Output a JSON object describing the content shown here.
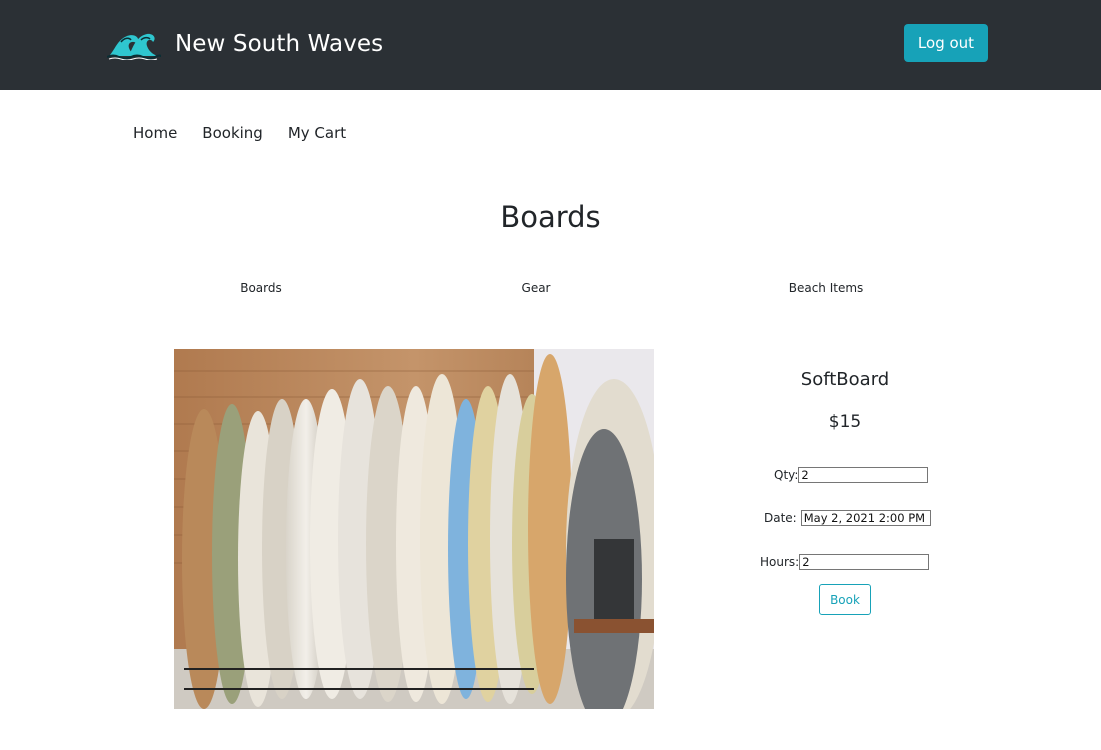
{
  "header": {
    "brand_name": "New South Waves",
    "logo_icon": "wave-logo-icon",
    "logout_label": "Log out",
    "background_color": "#2b3035",
    "accent_color": "#17a2b8"
  },
  "nav": {
    "items": [
      {
        "label": "Home"
      },
      {
        "label": "Booking"
      },
      {
        "label": "My Cart"
      }
    ]
  },
  "page": {
    "title": "Boards"
  },
  "categories": [
    {
      "label": "Boards"
    },
    {
      "label": "Gear"
    },
    {
      "label": "Beach Items"
    }
  ],
  "product": {
    "name": "SoftBoard",
    "price": "$15",
    "image_icon": "surfboard-rack-photo",
    "fields": {
      "qty": {
        "label": "Qty:",
        "value": "2"
      },
      "date": {
        "label": "Date:",
        "value": "May 2, 2021 2:00 PM"
      },
      "hours": {
        "label": "Hours:",
        "value": "2"
      }
    },
    "book_label": "Book"
  }
}
